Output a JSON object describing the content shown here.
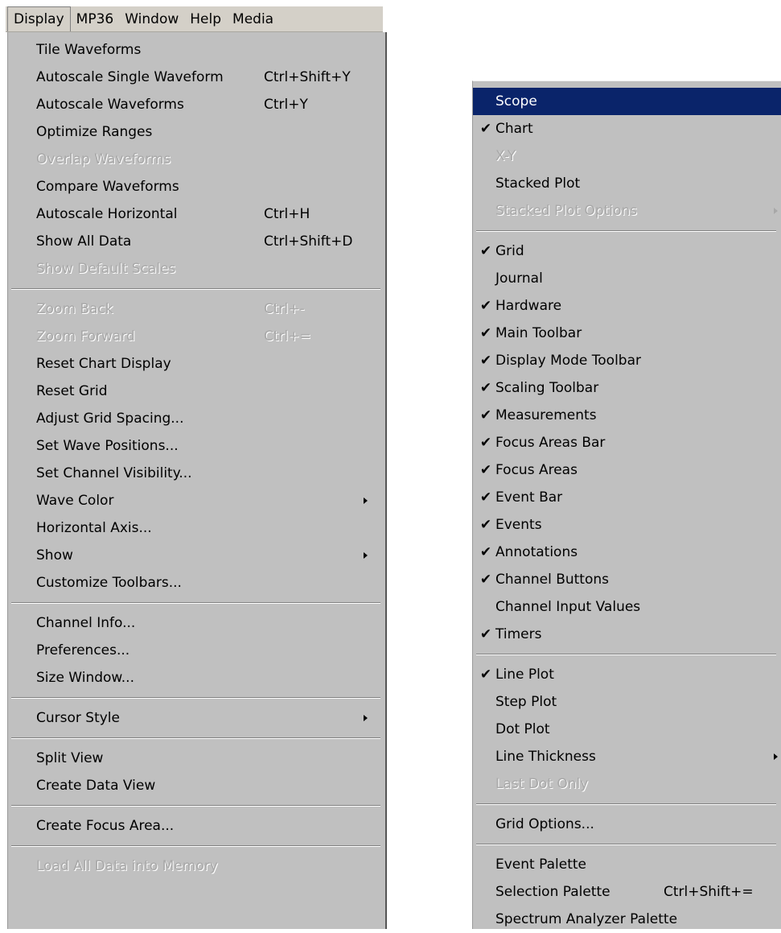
{
  "menubar": {
    "items": [
      "Display",
      "MP36",
      "Window",
      "Help",
      "Media"
    ]
  },
  "display_menu": {
    "items": [
      {
        "label": "Tile Waveforms",
        "shortcut": "",
        "disabled": false
      },
      {
        "label": "Autoscale Single Waveform",
        "shortcut": "Ctrl+Shift+Y",
        "disabled": false
      },
      {
        "label": "Autoscale Waveforms",
        "shortcut": "Ctrl+Y",
        "disabled": false
      },
      {
        "label": "Optimize Ranges",
        "shortcut": "",
        "disabled": false
      },
      {
        "label": "Overlap Waveforms",
        "shortcut": "",
        "disabled": true
      },
      {
        "label": "Compare Waveforms",
        "shortcut": "",
        "disabled": false
      },
      {
        "label": "Autoscale Horizontal",
        "shortcut": "Ctrl+H",
        "disabled": false
      },
      {
        "label": "Show All Data",
        "shortcut": "Ctrl+Shift+D",
        "disabled": false
      },
      {
        "label": "Show Default Scales",
        "shortcut": "",
        "disabled": true
      },
      {
        "label": "Zoom Back",
        "shortcut": "Ctrl+-",
        "disabled": true
      },
      {
        "label": "Zoom Forward",
        "shortcut": "Ctrl+=",
        "disabled": true
      },
      {
        "label": "Reset Chart Display",
        "shortcut": "",
        "disabled": false
      },
      {
        "label": "Reset Grid",
        "shortcut": "",
        "disabled": false
      },
      {
        "label": "Adjust Grid Spacing...",
        "shortcut": "",
        "disabled": false
      },
      {
        "label": "Set Wave Positions...",
        "shortcut": "",
        "disabled": false
      },
      {
        "label": "Set Channel Visibility...",
        "shortcut": "",
        "disabled": false
      },
      {
        "label": "Wave Color",
        "shortcut": "",
        "disabled": false
      },
      {
        "label": "Horizontal Axis...",
        "shortcut": "",
        "disabled": false
      },
      {
        "label": "Show",
        "shortcut": "",
        "disabled": false
      },
      {
        "label": "Customize Toolbars...",
        "shortcut": "",
        "disabled": false
      },
      {
        "label": "Channel Info...",
        "shortcut": "",
        "disabled": false
      },
      {
        "label": "Preferences...",
        "shortcut": "",
        "disabled": false
      },
      {
        "label": "Size Window...",
        "shortcut": "",
        "disabled": false
      },
      {
        "label": "Cursor Style",
        "shortcut": "",
        "disabled": false
      },
      {
        "label": "Split View",
        "shortcut": "",
        "disabled": false
      },
      {
        "label": "Create Data View",
        "shortcut": "",
        "disabled": false
      },
      {
        "label": "Create Focus Area...",
        "shortcut": "",
        "disabled": false
      },
      {
        "label": "Load All Data into Memory",
        "shortcut": "",
        "disabled": true
      }
    ]
  },
  "show_submenu": {
    "items": [
      {
        "label": "Scope",
        "checked": false,
        "disabled": false,
        "highlighted": true
      },
      {
        "label": "Chart",
        "checked": true,
        "disabled": false
      },
      {
        "label": "X-Y",
        "checked": false,
        "disabled": true
      },
      {
        "label": "Stacked Plot",
        "checked": false,
        "disabled": false
      },
      {
        "label": "Stacked Plot Options",
        "checked": false,
        "disabled": true
      },
      {
        "label": "Grid",
        "checked": true,
        "disabled": false
      },
      {
        "label": "Journal",
        "checked": false,
        "disabled": false
      },
      {
        "label": "Hardware",
        "checked": true,
        "disabled": false
      },
      {
        "label": "Main Toolbar",
        "checked": true,
        "disabled": false
      },
      {
        "label": "Display Mode Toolbar",
        "checked": true,
        "disabled": false
      },
      {
        "label": "Scaling Toolbar",
        "checked": true,
        "disabled": false
      },
      {
        "label": "Measurements",
        "checked": true,
        "disabled": false
      },
      {
        "label": "Focus Areas Bar",
        "checked": true,
        "disabled": false
      },
      {
        "label": "Focus Areas",
        "checked": true,
        "disabled": false
      },
      {
        "label": "Event Bar",
        "checked": true,
        "disabled": false
      },
      {
        "label": "Events",
        "checked": true,
        "disabled": false
      },
      {
        "label": "Annotations",
        "checked": true,
        "disabled": false
      },
      {
        "label": "Channel Buttons",
        "checked": true,
        "disabled": false
      },
      {
        "label": "Channel Input Values",
        "checked": false,
        "disabled": false
      },
      {
        "label": "Timers",
        "checked": true,
        "disabled": false
      },
      {
        "label": "Line Plot",
        "checked": true,
        "disabled": false
      },
      {
        "label": "Step Plot",
        "checked": false,
        "disabled": false
      },
      {
        "label": "Dot Plot",
        "checked": false,
        "disabled": false
      },
      {
        "label": "Line Thickness",
        "checked": false,
        "disabled": false
      },
      {
        "label": "Last Dot Only",
        "checked": false,
        "disabled": true
      },
      {
        "label": "Grid Options...",
        "checked": false,
        "disabled": false
      },
      {
        "label": "Event Palette",
        "checked": false,
        "disabled": false
      },
      {
        "label": "Selection Palette",
        "checked": false,
        "disabled": false,
        "shortcut": "Ctrl+Shift+="
      },
      {
        "label": "Spectrum Analyzer Palette",
        "checked": false,
        "disabled": false
      }
    ]
  },
  "icons": {
    "check": "✔",
    "submenu_arrow": "submenu-arrow-icon"
  },
  "colors": {
    "menu_bg": "#c0c0c0",
    "highlight_bg": "#0a246a",
    "highlight_text": "#ffffff",
    "disabled_text": "#a8a8a8"
  }
}
